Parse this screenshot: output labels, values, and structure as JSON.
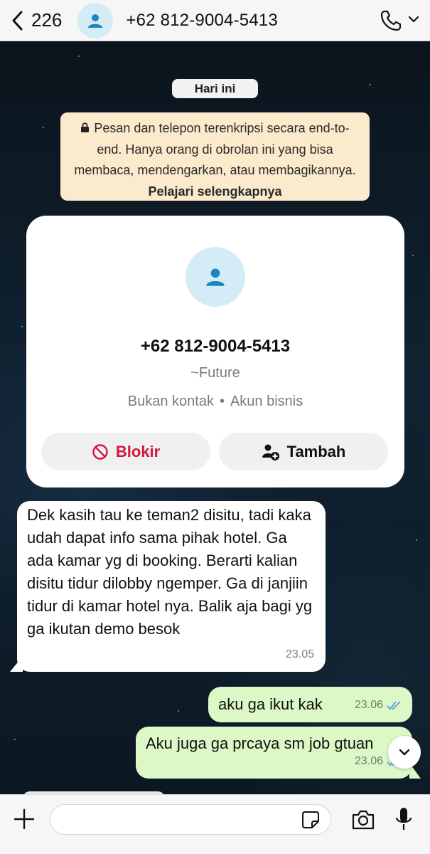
{
  "header": {
    "back_count": "226",
    "title": "+62 812-9004-5413",
    "icons": [
      "back-chevron-icon",
      "contact-avatar-icon",
      "phone-call-icon",
      "chevron-down-icon"
    ]
  },
  "chat": {
    "date_pill": "Hari ini",
    "encryption": {
      "text": "Pesan dan telepon terenkripsi secara end-to-end. Hanya orang di obrolan ini yang bisa membaca, mendengarkan, atau membagikannya.",
      "link": "Pelajari selengkapnya"
    },
    "contact_card": {
      "phone": "+62 812-9004-5413",
      "name": "~Future",
      "status": "Bukan kontak",
      "account_type": "Akun bisnis",
      "separator": "•",
      "block_label": "Blokir",
      "add_label": "Tambah"
    },
    "messages": [
      {
        "direction": "incoming",
        "text": "Dek kasih tau ke teman2 disitu, tadi kaka udah dapat info sama pihak hotel. Ga ada kamar yg di booking. Berarti kalian disitu tidur dilobby ngemper. Ga di janjiin tidur di kamar hotel nya. Balik aja bagi yg ga ikutan demo besok",
        "time": "23.05"
      },
      {
        "direction": "outgoing",
        "text": "aku ga ikut kak",
        "time": "23.06",
        "status": "read"
      },
      {
        "direction": "outgoing",
        "text": "Aku juga ga prcaya sm job gtuan",
        "time": "23.06",
        "status": "read"
      }
    ]
  },
  "composer": {
    "placeholder": "",
    "icons": [
      "plus-icon",
      "sticker-icon",
      "camera-icon",
      "microphone-icon"
    ]
  },
  "colors": {
    "outgoing_bubble": "#dcf8c6",
    "incoming_bubble": "#ffffff",
    "block_red": "#d3163c",
    "read_ticks": "#4fa3e0",
    "encryption_bg": "#fbeacb"
  }
}
